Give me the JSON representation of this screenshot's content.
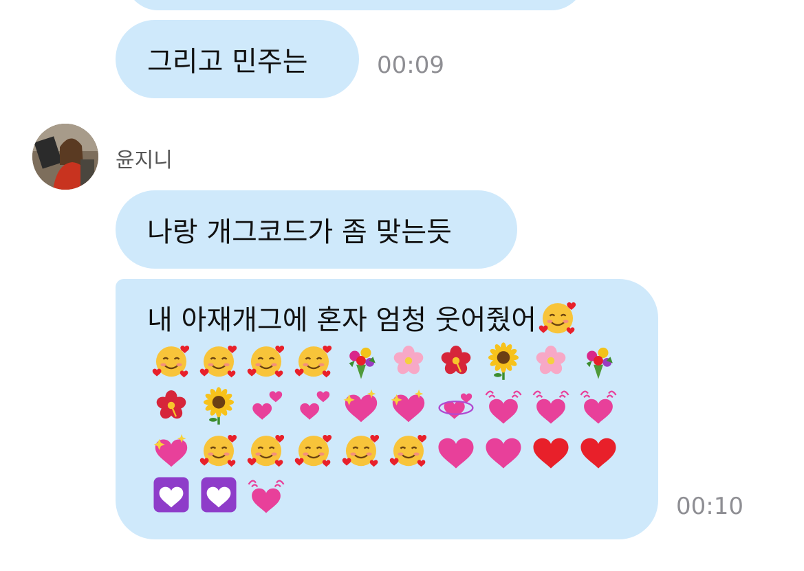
{
  "messages": {
    "m1": {
      "text": "그리고 민주는",
      "time": "00:09"
    },
    "sender": {
      "name": "윤지니"
    },
    "m2": {
      "text": "나랑 개그코드가 좀 맞는듯"
    },
    "m3": {
      "text": "내 아재개그에 혼자 엄청 웃어줬어",
      "time": "00:10",
      "inline_emoji": "smiling-face-with-hearts",
      "emojis": [
        "smiling-face-with-hearts",
        "smiling-face-with-hearts",
        "smiling-face-with-hearts",
        "smiling-face-with-hearts",
        "bouquet",
        "cherry-blossom",
        "hibiscus",
        "sunflower",
        "cherry-blossom",
        "bouquet",
        "hibiscus",
        "sunflower",
        "two-hearts",
        "two-hearts",
        "sparkling-heart",
        "sparkling-heart",
        "revolving-hearts",
        "beating-heart",
        "beating-heart",
        "beating-heart",
        "sparkling-heart",
        "smiling-face-with-hearts",
        "smiling-face-with-hearts",
        "smiling-face-with-hearts",
        "smiling-face-with-hearts",
        "smiling-face-with-hearts",
        "pink-heart",
        "pink-heart",
        "red-heart",
        "red-heart",
        "white-heart-purple-square",
        "white-heart-purple-square",
        "beating-heart"
      ]
    }
  },
  "colors": {
    "bubble": "#cfe9fb",
    "timestamp": "#8e8e93",
    "sender": "#555555"
  }
}
